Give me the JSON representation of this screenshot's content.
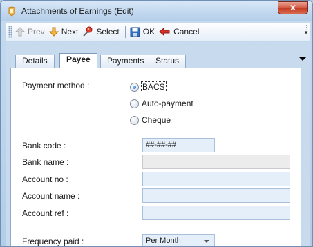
{
  "window": {
    "title": "Attachments of Earnings (Edit)",
    "close_glyph": "x"
  },
  "toolbar": {
    "prev_label": "Prev",
    "next_label": "Next",
    "select_label": "Select",
    "ok_label": "OK",
    "cancel_label": "Cancel"
  },
  "tabs": [
    {
      "label": "Details",
      "active": false
    },
    {
      "label": "Payee",
      "active": true
    },
    {
      "label": "Payments",
      "active": false
    },
    {
      "label": "Status",
      "active": false
    }
  ],
  "form": {
    "payment_method_label": "Payment method :",
    "payment_options": [
      {
        "label": "BACS",
        "checked": true
      },
      {
        "label": "Auto-payment",
        "checked": false
      },
      {
        "label": "Cheque",
        "checked": false
      }
    ],
    "bank_code_label": "Bank code :",
    "bank_code_value": "##-##-##",
    "bank_name_label": "Bank name :",
    "bank_name_value": "",
    "account_no_label": "Account no :",
    "account_no_value": "",
    "account_name_label": "Account name :",
    "account_name_value": "",
    "account_ref_label": "Account ref :",
    "account_ref_value": "",
    "frequency_label": "Frequency paid :",
    "frequency_value": "Per Month"
  },
  "colors": {
    "field_bg": "#e5effa",
    "readonly_bg": "#ececec",
    "close_red": "#c33a24"
  }
}
